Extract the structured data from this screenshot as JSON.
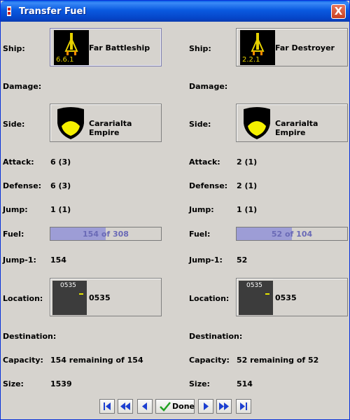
{
  "window": {
    "title": "Transfer Fuel",
    "close": "X"
  },
  "labels": {
    "ship": "Ship:",
    "damage": "Damage:",
    "side": "Side:",
    "attack": "Attack:",
    "defense": "Defense:",
    "jump": "Jump:",
    "fuel": "Fuel:",
    "jump_minus_1": "Jump-1:",
    "location": "Location:",
    "destination": "Destination:",
    "capacity": "Capacity:",
    "size": "Size:"
  },
  "left": {
    "ship_name": "Far Battleship",
    "ship_code": "6.6.1",
    "side": "Cararialta Empire",
    "attack": "6 (3)",
    "defense": "6 (3)",
    "jump": "1 (1)",
    "fuel_text": "154 of 308",
    "fuel_fraction": 0.5,
    "jump_minus_1": "154",
    "location_code": "0535",
    "location": "0535",
    "capacity": "154 remaining of 154",
    "size": "1539"
  },
  "right": {
    "ship_name": "Far Destroyer",
    "ship_code": "2.2.1",
    "side": "Cararialta Empire",
    "attack": "2 (1)",
    "defense": "2 (1)",
    "jump": "1 (1)",
    "fuel_text": "52 of 104",
    "fuel_fraction": 0.5,
    "jump_minus_1": "52",
    "location_code": "0535",
    "location": "0535",
    "capacity": "52 remaining of 52",
    "size": "514"
  },
  "nav": {
    "done_label": "Done",
    "buttons": [
      "first-icon",
      "fast-back-icon",
      "back-icon",
      "forward-icon",
      "fast-forward-icon",
      "last-icon"
    ]
  },
  "colors": {
    "title_bar": "#0a5ae0",
    "fuel_fill": "#9d9dd6",
    "fuel_text": "#6a6ab6",
    "shield_yellow": "#f5f000",
    "ship_code": "#e6d200",
    "nav_blue": "#1c3fd0"
  }
}
